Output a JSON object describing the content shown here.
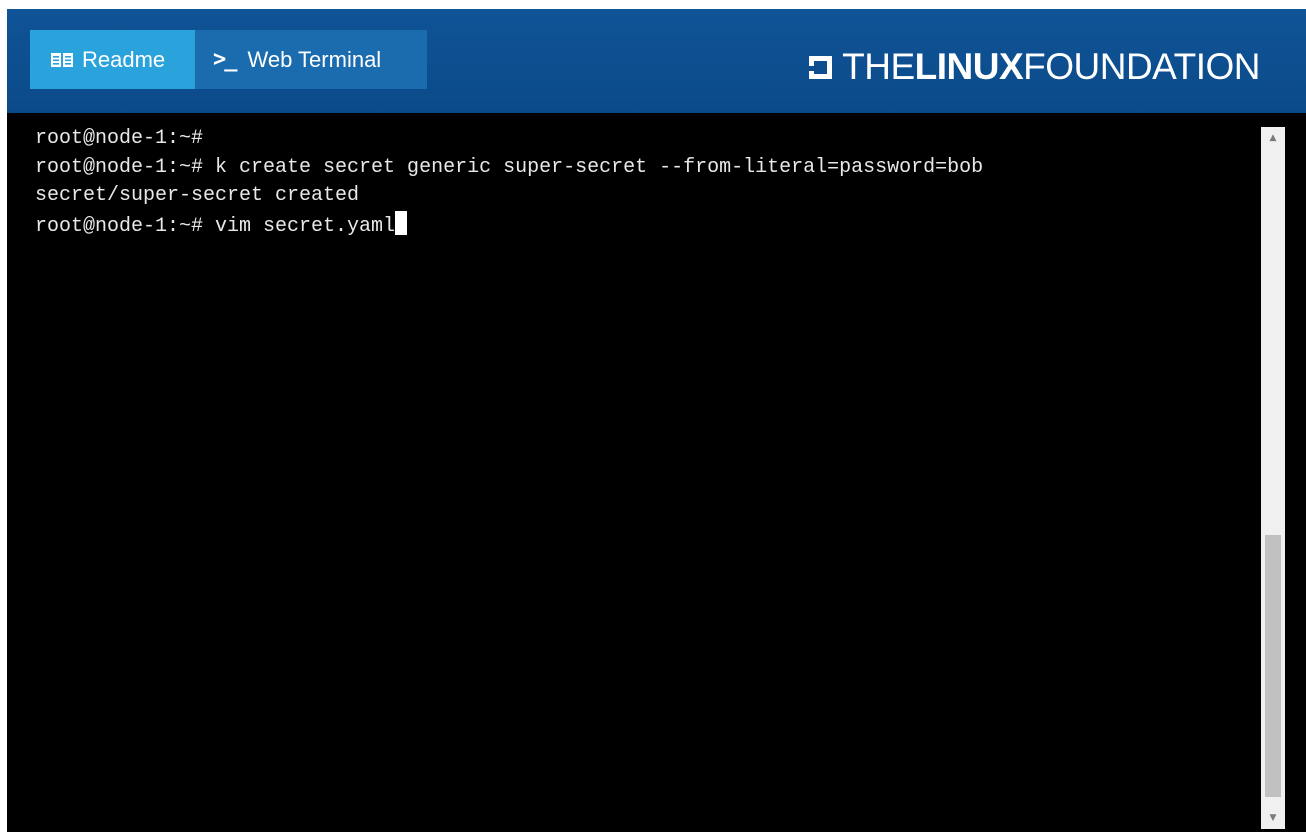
{
  "tabs": {
    "readme": {
      "label": "Readme",
      "icon": "book-icon"
    },
    "terminal": {
      "label": "Web Terminal",
      "icon": "terminal-prompt-icon",
      "icon_glyph": ">_"
    }
  },
  "brand": {
    "part1": "THE",
    "part2": "LINUX",
    "part3": "FOUNDATION"
  },
  "terminal": {
    "lines": [
      "root@node-1:~#",
      "root@node-1:~# k create secret generic super-secret --from-literal=password=bob",
      "secret/super-secret created",
      "root@node-1:~# vim secret.yaml"
    ]
  },
  "colors": {
    "header": "#0c4d8e",
    "readme_tab": "#2aa3dd",
    "terminal_tab": "#1b6cae",
    "terminal_bg": "#000000"
  }
}
